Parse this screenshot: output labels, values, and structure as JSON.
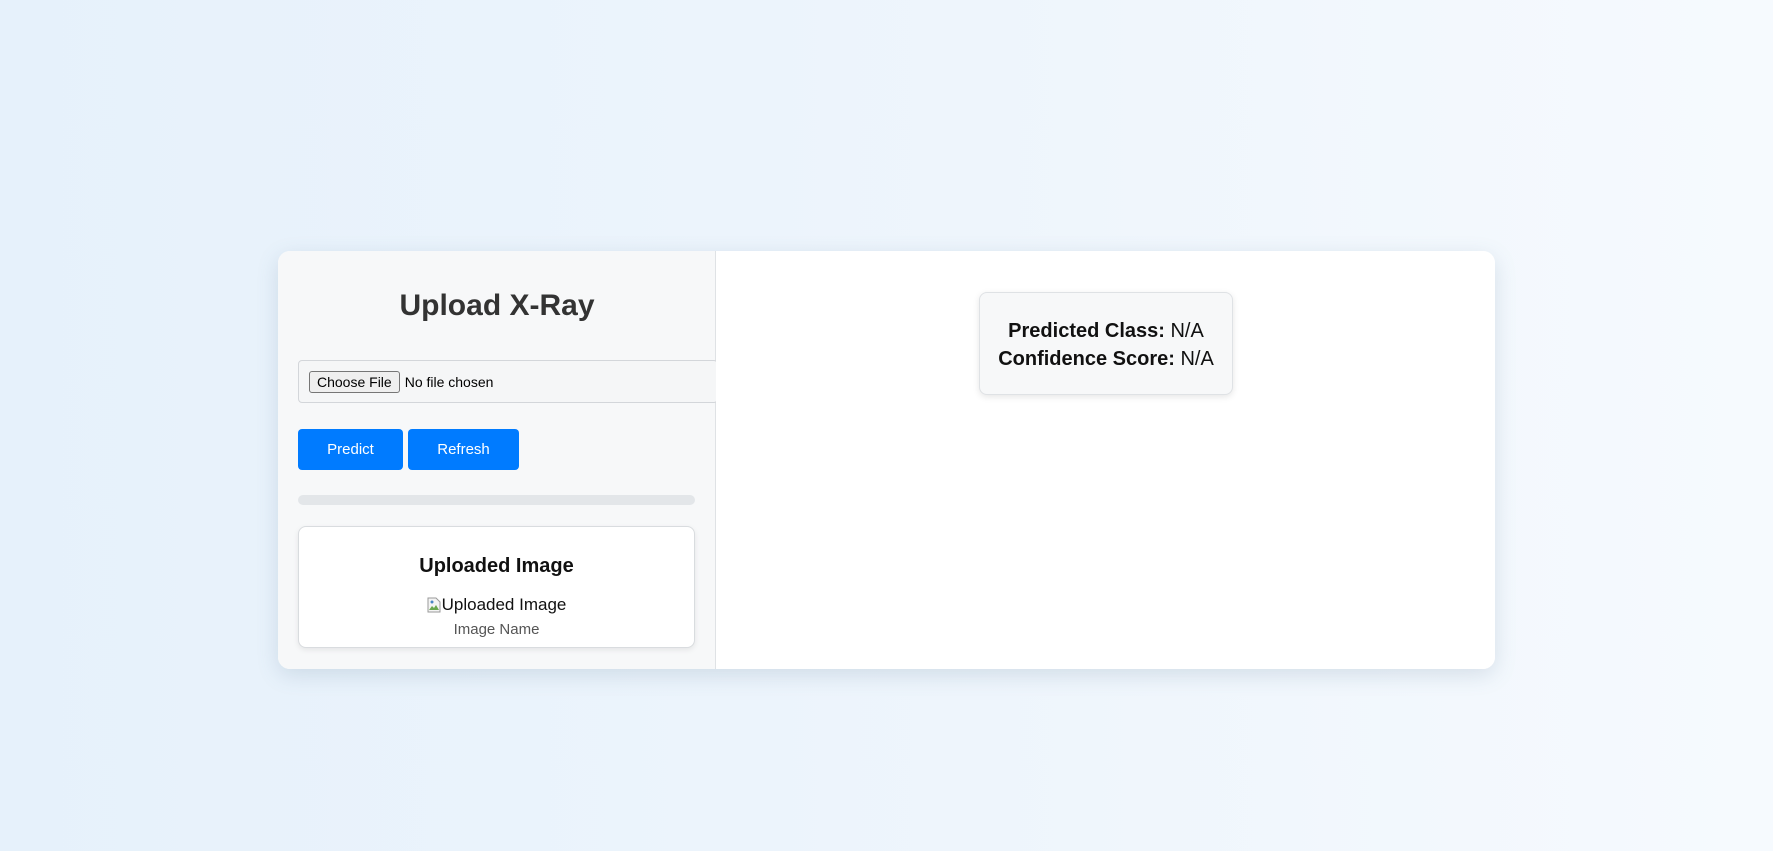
{
  "upload_panel": {
    "title": "Upload X-Ray",
    "file_input": {
      "button_label": "Choose File",
      "status_text": "No file chosen"
    },
    "buttons": {
      "predict_label": "Predict",
      "refresh_label": "Refresh"
    },
    "progress_percent": 0,
    "uploaded_card": {
      "title": "Uploaded Image",
      "image_alt": "Uploaded Image",
      "image_name": "Image Name"
    }
  },
  "results": {
    "predicted_class_label": "Predicted Class:",
    "predicted_class_value": "N/A",
    "confidence_label": "Confidence Score:",
    "confidence_value": "N/A"
  },
  "colors": {
    "accent": "#007bff",
    "title_text": "#333333",
    "muted_text": "#555555"
  }
}
